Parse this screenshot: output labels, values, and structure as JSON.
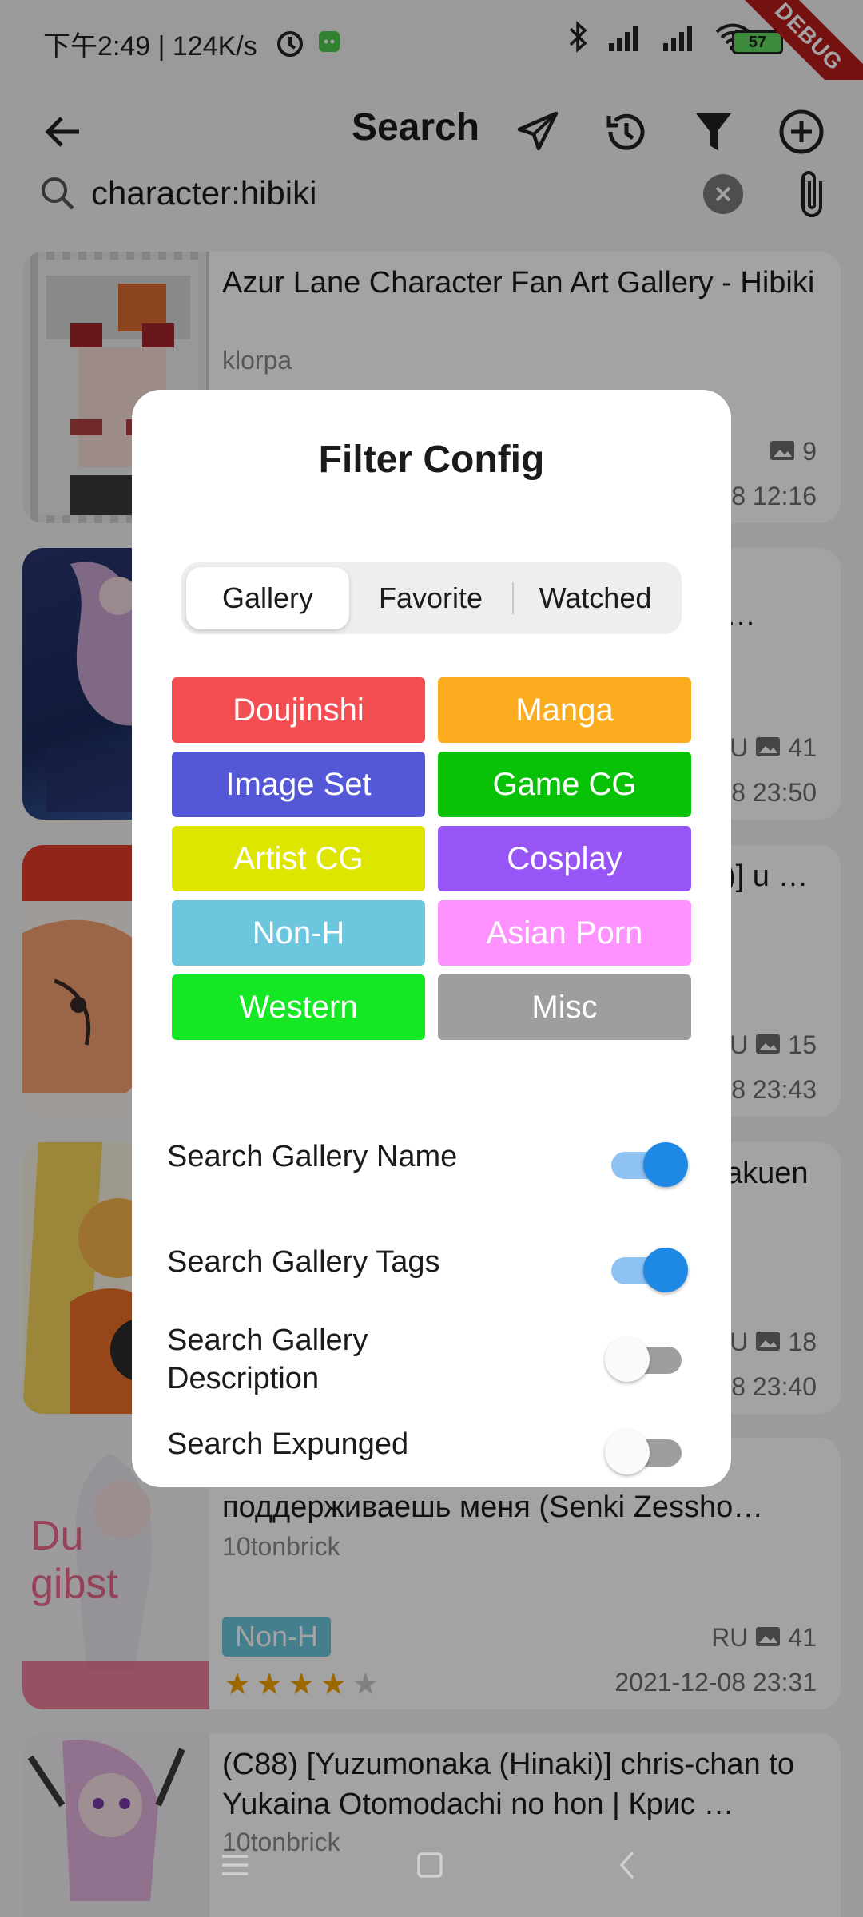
{
  "status_bar": {
    "time_speed": "下午2:49 | 124K/s",
    "battery": "57",
    "debug_label": "DEBUG"
  },
  "app_bar": {
    "title": "Search"
  },
  "search": {
    "value": "character:hibiki"
  },
  "gallery": [
    {
      "title": "Azur Lane Character Fan Art Gallery - Hibiki",
      "uploader": "klorpa",
      "pages": "9",
      "date": "8 12:16"
    },
    {
      "title": "…",
      "language": "U",
      "pages": "41",
      "date": "8 23:50"
    },
    {
      "title": ")] u …",
      "language": "U",
      "pages": "15",
      "date": "8 23:43"
    },
    {
      "title": "akuen",
      "language": "U",
      "pages": "18",
      "date": "8 23:40"
    },
    {
      "title": "поддерживаешь меня (Senki Zessho…",
      "uploader": "10tonbrick",
      "category": "Non-H",
      "language": "RU",
      "pages": "41",
      "date": "2021-12-08 23:31",
      "rating": 4
    },
    {
      "title": "(C88) [Yuzumonaka (Hinaki)] chris-chan to Yukaina Otomodachi no hon | Крис …",
      "uploader": "10tonbrick"
    }
  ],
  "dialog": {
    "title": "Filter Config",
    "tabs": [
      {
        "label": "Gallery",
        "active": true
      },
      {
        "label": "Favorite",
        "active": false
      },
      {
        "label": "Watched",
        "active": false
      }
    ],
    "categories": [
      {
        "label": "Doujinshi",
        "color": "#f44e52"
      },
      {
        "label": "Manga",
        "color": "#fbad1f"
      },
      {
        "label": "Image Set",
        "color": "#5458d7"
      },
      {
        "label": "Game CG",
        "color": "#08c208"
      },
      {
        "label": "Artist CG",
        "color": "#dde500"
      },
      {
        "label": "Cosplay",
        "color": "#9755f5"
      },
      {
        "label": "Non-H",
        "color": "#6cc6dd"
      },
      {
        "label": "Asian Porn",
        "color": "#fe93ff"
      },
      {
        "label": "Western",
        "color": "#14e723"
      },
      {
        "label": "Misc",
        "color": "#9e9e9e"
      }
    ],
    "options": [
      {
        "label": "Search Gallery Name",
        "on": true
      },
      {
        "label": "Search Gallery Tags",
        "on": true
      },
      {
        "label": "Search Gallery Description",
        "on": false
      },
      {
        "label": "Search Expunged",
        "on": false
      }
    ]
  },
  "colors": {
    "accent": "#1e88e5",
    "non_h": "#6cc6dd",
    "star": "#f5a200"
  }
}
